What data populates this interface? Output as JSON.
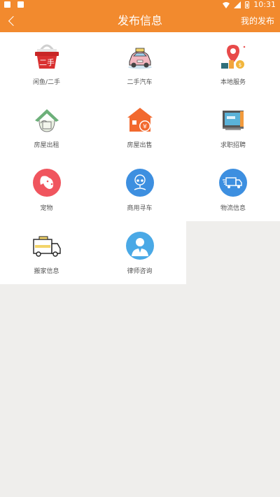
{
  "statusbar": {
    "time": "10:31"
  },
  "appbar": {
    "title": "发布信息",
    "action": "我的发布"
  },
  "items": [
    {
      "label": "闲鱼/二手",
      "icon": "secondhand-basket-icon"
    },
    {
      "label": "二手汽车",
      "icon": "used-car-icon"
    },
    {
      "label": "本地服务",
      "icon": "local-service-icon"
    },
    {
      "label": "房屋出租",
      "icon": "house-rent-icon"
    },
    {
      "label": "房屋出售",
      "icon": "house-sale-icon"
    },
    {
      "label": "求职招聘",
      "icon": "job-recruit-icon"
    },
    {
      "label": "宠物",
      "icon": "pet-dog-icon"
    },
    {
      "label": "商用寻车",
      "icon": "commercial-car-icon"
    },
    {
      "label": "物流信息",
      "icon": "logistics-truck-icon"
    },
    {
      "label": "搬家信息",
      "icon": "moving-truck-icon"
    },
    {
      "label": "律师咨询",
      "icon": "lawyer-icon"
    }
  ],
  "badge_text": "二手"
}
